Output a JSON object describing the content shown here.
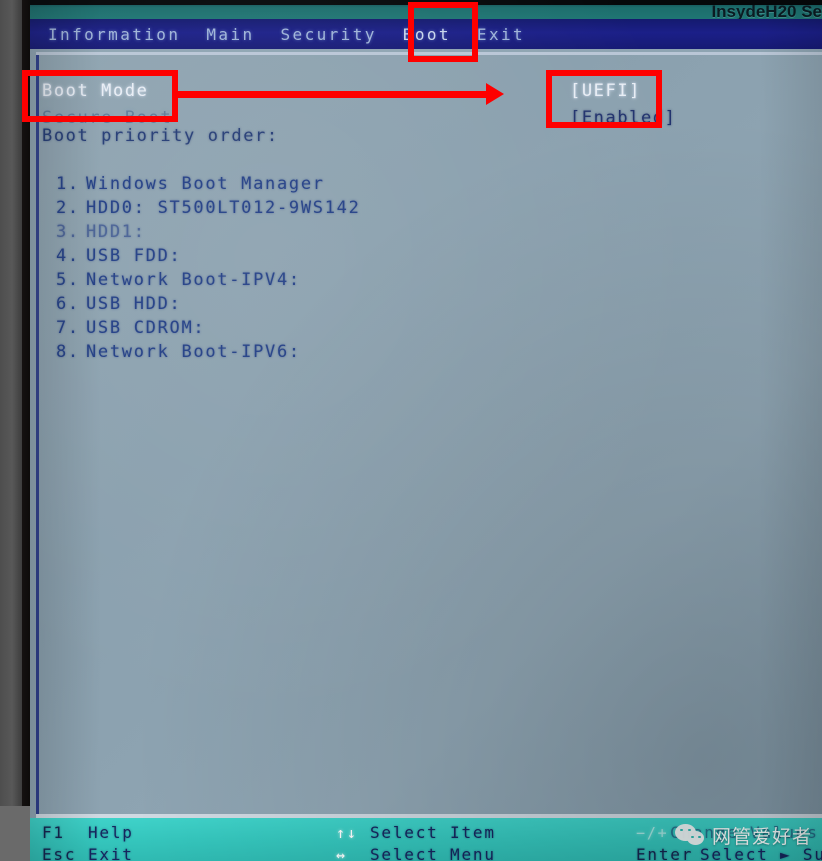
{
  "firmware": {
    "brand": "InsydeH20 Se"
  },
  "menubar": {
    "items": [
      {
        "label": "Information"
      },
      {
        "label": "Main"
      },
      {
        "label": "Security"
      },
      {
        "label": "Boot"
      },
      {
        "label": "Exit"
      }
    ],
    "active": "Boot"
  },
  "settings": [
    {
      "label": "Boot Mode",
      "value": "[UEFI]"
    },
    {
      "label": "Secure Boot",
      "value": "[Enabled]"
    }
  ],
  "section": {
    "heading": "Boot priority order:"
  },
  "boot_order": [
    {
      "num": "1.",
      "name": "Windows Boot Manager"
    },
    {
      "num": "2.",
      "name": "HDD0: ST500LT012-9WS142"
    },
    {
      "num": "3.",
      "name": "HDD1:"
    },
    {
      "num": "4.",
      "name": "USB FDD:"
    },
    {
      "num": "5.",
      "name": "Network Boot-IPV4:"
    },
    {
      "num": "6.",
      "name": "USB HDD:"
    },
    {
      "num": "7.",
      "name": "USB CDROM:"
    },
    {
      "num": "8.",
      "name": "Network Boot-IPV6:"
    }
  ],
  "help": {
    "f1_key": "F1",
    "f1_label": "Help",
    "esc_key": "Esc",
    "esc_label": "Exit",
    "updown_arrow": "↑↓",
    "updown_label": "Select Item",
    "leftright_arrow": "↔",
    "leftright_label": "Select Menu",
    "change_arrow": "−/+",
    "change_label": "Change Values",
    "enter_key": "Enter",
    "enter_label": "Select ► SubMenu"
  },
  "watermark": {
    "text": "网管爱好者"
  },
  "annotations": {
    "tab_box": "Boot",
    "label_box": "Boot Mode",
    "value_box": "[UEFI]"
  },
  "colors": {
    "menubar_bg": "#1b1f88",
    "top_band": "#1f7573",
    "panel_bg": "#8fa4b1",
    "bottom_bar": "#35c6bd",
    "annotation_red": "#fe0000",
    "selected_text": "#e9eef5",
    "body_text": "#1f3c84"
  }
}
